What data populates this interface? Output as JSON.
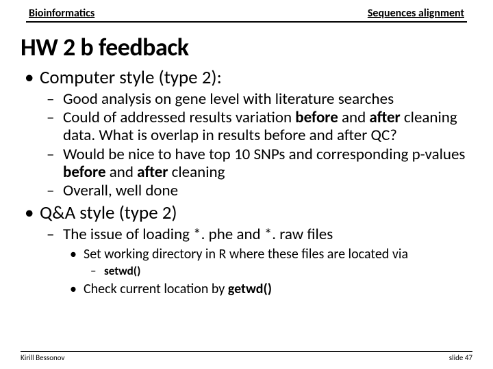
{
  "header": {
    "left": "Bioinformatics",
    "right": "Sequences alignment"
  },
  "title": "HW 2 b feedback",
  "b1": {
    "text": "Computer style (type 2):",
    "s1": "Good analysis on gene level with literature searches",
    "s2a": "Could of addressed results variation ",
    "s2b": "before",
    "s2c": " and ",
    "s2d": "after",
    "s2e": " cleaning data. What is overlap in results before and after QC?",
    "s3a": "Would be nice to have top 10 SNPs and corresponding p-values ",
    "s3b": "before",
    "s3c": " and ",
    "s3d": "after",
    "s3e": " cleaning",
    "s4": "Overall, well done"
  },
  "b2": {
    "text": "Q&A style (type 2)",
    "s1": "The issue of loading *. phe and *. raw files",
    "t1": "Set working directory in R where these files are located via",
    "u1": "setwd()",
    "t2a": "Check current location by ",
    "t2b": "getwd()"
  },
  "footer": {
    "left": "Kirill Bessonov",
    "right": "slide 47"
  }
}
